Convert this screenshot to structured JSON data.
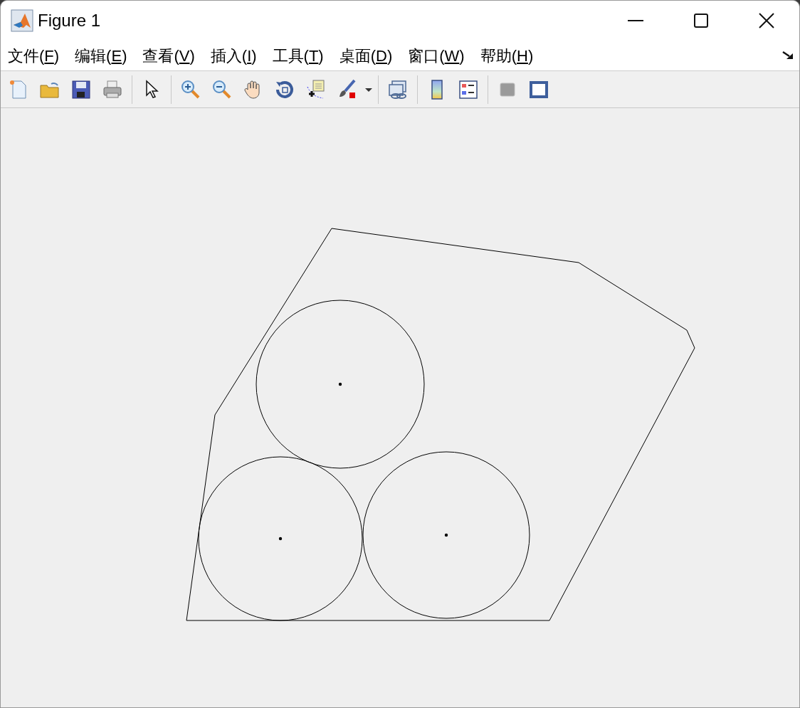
{
  "window": {
    "title": "Figure 1"
  },
  "menu": [
    {
      "before": "文件(",
      "key": "F",
      "after": ")"
    },
    {
      "before": "编辑(",
      "key": "E",
      "after": ")"
    },
    {
      "before": "查看(",
      "key": "V",
      "after": ")"
    },
    {
      "before": "插入(",
      "key": "I",
      "after": ")"
    },
    {
      "before": "工具(",
      "key": "T",
      "after": ")"
    },
    {
      "before": "桌面(",
      "key": "D",
      "after": ")"
    },
    {
      "before": "窗口(",
      "key": "W",
      "after": ")"
    },
    {
      "before": "帮助(",
      "key": "H",
      "after": ")"
    }
  ],
  "toolbar": [
    {
      "kind": "new"
    },
    {
      "kind": "open"
    },
    {
      "kind": "save"
    },
    {
      "kind": "print"
    },
    {
      "kind": "separator"
    },
    {
      "kind": "pointer"
    },
    {
      "kind": "separator"
    },
    {
      "kind": "zoom-in"
    },
    {
      "kind": "zoom-out"
    },
    {
      "kind": "pan"
    },
    {
      "kind": "rotate"
    },
    {
      "kind": "datatip"
    },
    {
      "kind": "brush"
    },
    {
      "kind": "dropdown"
    },
    {
      "kind": "separator"
    },
    {
      "kind": "link"
    },
    {
      "kind": "separator"
    },
    {
      "kind": "colorbar"
    },
    {
      "kind": "legend"
    },
    {
      "kind": "separator"
    },
    {
      "kind": "hide-tools"
    },
    {
      "kind": "show-tools"
    }
  ]
}
